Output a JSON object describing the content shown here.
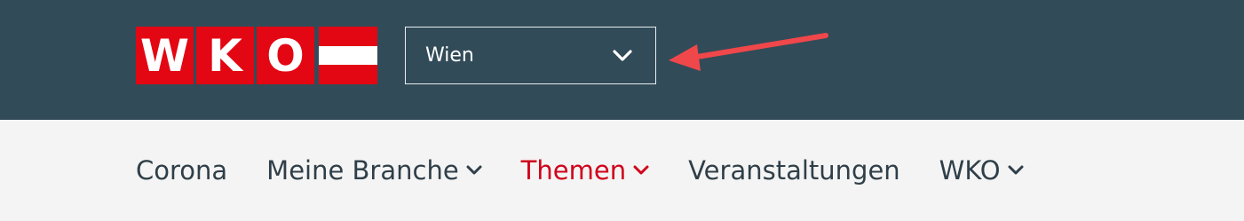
{
  "colors": {
    "header_bg": "#324b58",
    "brand_red": "#e30613",
    "nav_text": "#2f3f49",
    "nav_active": "#d0021b",
    "page_bg": "#f4f4f4",
    "annotation_arrow": "#f0474b"
  },
  "header": {
    "logo": {
      "letters": [
        "W",
        "K",
        "O"
      ]
    },
    "region_select": {
      "value": "Wien",
      "icon": "chevron-down-icon"
    }
  },
  "nav": {
    "items": [
      {
        "label": "Corona",
        "has_dropdown": false,
        "active": false
      },
      {
        "label": "Meine Branche",
        "has_dropdown": true,
        "active": false
      },
      {
        "label": "Themen",
        "has_dropdown": true,
        "active": true
      },
      {
        "label": "Veranstaltungen",
        "has_dropdown": false,
        "active": false
      },
      {
        "label": "WKO",
        "has_dropdown": true,
        "active": false
      }
    ]
  },
  "annotation": {
    "icon": "arrow-icon",
    "points_to": "region-select"
  }
}
